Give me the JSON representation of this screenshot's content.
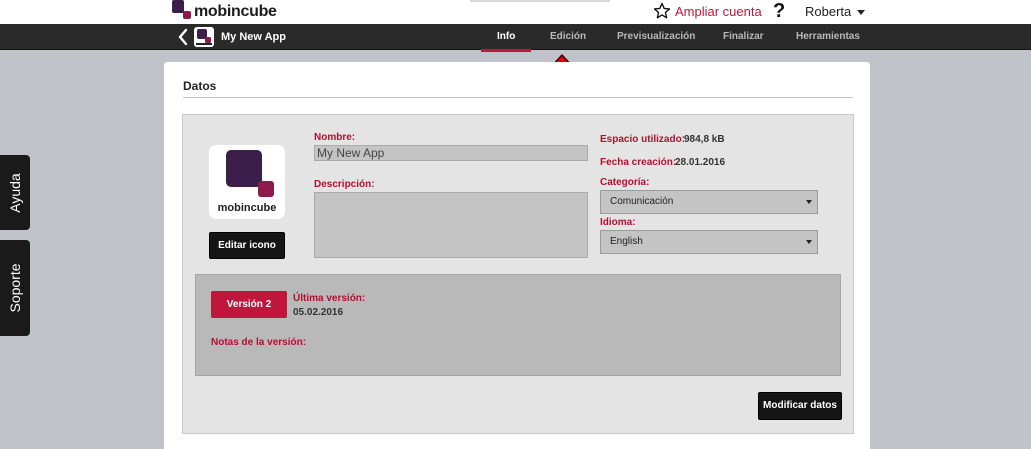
{
  "header": {
    "brand": "mobincube",
    "upgrade_label": "Ampliar cuenta",
    "help_label": "?",
    "user_name": "Roberta"
  },
  "nav": {
    "app_name": "My New App",
    "tabs": [
      {
        "label": "Info",
        "active": true
      },
      {
        "label": "Edición",
        "active": false
      },
      {
        "label": "Previsualización",
        "active": false
      },
      {
        "label": "Finalizar",
        "active": false
      },
      {
        "label": "Herramientas",
        "active": false
      }
    ]
  },
  "side": {
    "help_tab": "Ayuda",
    "support_tab": "Soporte"
  },
  "main": {
    "section_title": "Datos",
    "icon_brand": "mobincube",
    "edit_icon_button": "Editar icono",
    "name_label": "Nombre:",
    "name_value": "My New App",
    "description_label": "Descripción:",
    "description_value": "",
    "space_label": "Espacio utilizado:",
    "space_value": "984,8 kB",
    "created_label": "Fecha creación:",
    "created_value": "28.01.2016",
    "category_label": "Categoría:",
    "category_value": "Comunicación",
    "language_label": "Idioma:",
    "language_value": "English",
    "version_button": "Versión 2",
    "last_version_label": "Última versión:",
    "last_version_date": "05.02.2016",
    "version_notes_label": "Notas de la versión:",
    "modify_button": "Modificar datos"
  },
  "colors": {
    "accent": "#c0163c",
    "nav_bg": "#2a2a2a",
    "arrow": "#e8000b",
    "brand_purple": "#5a1d4f"
  },
  "icons": {
    "upgrade": "star-outline-icon",
    "back": "chevron-left-icon",
    "annotation": "red-up-arrow"
  }
}
